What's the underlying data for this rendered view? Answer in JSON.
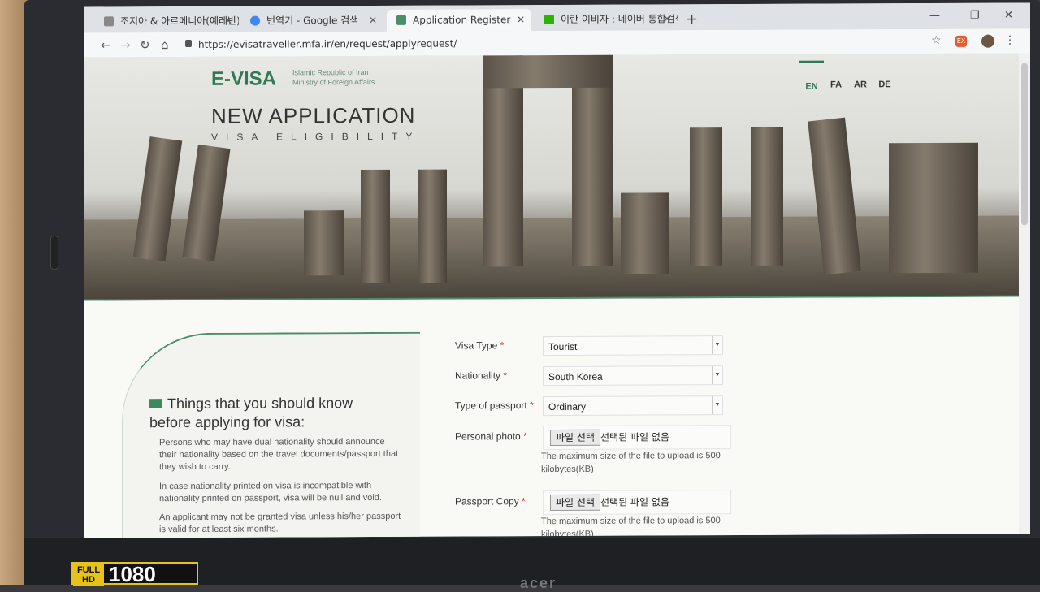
{
  "tabs": [
    {
      "label": "조지아 & 아르메니아(예레반) 여",
      "icon_color": "#888888"
    },
    {
      "label": "번역기 - Google 검색",
      "icon_color": "#4285f4"
    },
    {
      "label": "Application Register",
      "icon_color": "#4a8f6a"
    },
    {
      "label": "이란 이비자 : 네이버 통합검색",
      "icon_color": "#2db400"
    }
  ],
  "toolbar": {
    "url": "https://evisatraveller.mfa.ir/en/request/applyrequest/",
    "ext_label": "EX"
  },
  "header": {
    "logo": "E-VISA",
    "logo_sub_1": "Islamic Republic of Iran",
    "logo_sub_2": "Ministry of Foreign Affairs",
    "title": "NEW APPLICATION",
    "subtitle": "VISA ELIGIBILITY",
    "languages": [
      "EN",
      "FA",
      "AR",
      "DE"
    ],
    "active_language": "EN"
  },
  "info": {
    "title": "Things that you should know before applying for visa:",
    "paragraphs": [
      "Persons who may have dual nationality should announce their nationality based on the travel documents/passport that they wish to carry.",
      "In case nationality printed on visa is incompatible with nationality printed on passport, visa will be null and void.",
      "An applicant may not be granted visa unless his/her passport is valid for at least six months."
    ]
  },
  "form": {
    "visa_type_label": "Visa Type",
    "visa_type_value": "Tourist",
    "nationality_label": "Nationality",
    "nationality_value": "South Korea",
    "passport_type_label": "Type of passport",
    "passport_type_value": "Ordinary",
    "photo_label": "Personal photo",
    "passport_copy_label": "Passport Copy",
    "file_button": "파일 선택",
    "no_file": "선택된 파일 없음",
    "size_hint": "The maximum size of the file to upload is 500 kilobytes(KB)",
    "required_mark": "*"
  },
  "laptop": {
    "sticker_top": "FULL HD",
    "sticker_num": "1080",
    "brand": "acer"
  },
  "colors": {
    "accent": "#2f7a55",
    "required": "#dd3333"
  }
}
